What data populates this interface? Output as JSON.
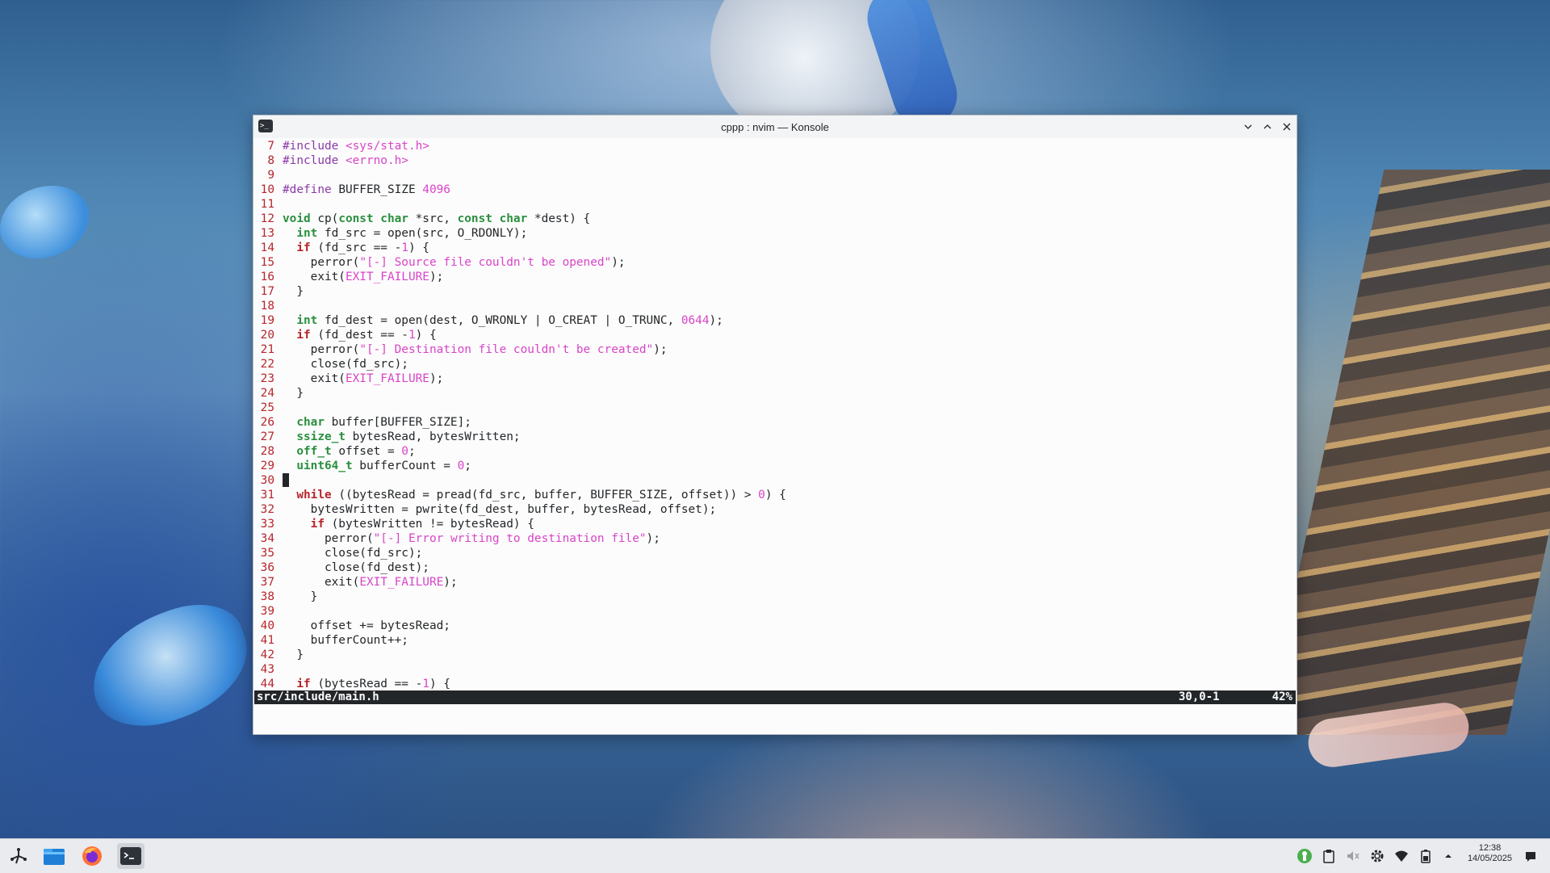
{
  "window": {
    "title": "cppp : nvim — Konsole",
    "app_icon_glyph": ">_"
  },
  "editor": {
    "lines": [
      {
        "n": "7",
        "segs": [
          {
            "t": "pp",
            "v": "#include "
          },
          {
            "t": "str",
            "v": "<sys/stat.h>"
          }
        ]
      },
      {
        "n": "8",
        "segs": [
          {
            "t": "pp",
            "v": "#include "
          },
          {
            "t": "str",
            "v": "<errno.h>"
          }
        ]
      },
      {
        "n": "9",
        "segs": []
      },
      {
        "n": "10",
        "segs": [
          {
            "t": "pp",
            "v": "#define "
          },
          {
            "t": "",
            "v": "BUFFER_SIZE "
          },
          {
            "t": "num",
            "v": "4096"
          }
        ]
      },
      {
        "n": "11",
        "segs": []
      },
      {
        "n": "12",
        "segs": [
          {
            "t": "ty",
            "v": "void"
          },
          {
            "t": "",
            "v": " cp("
          },
          {
            "t": "ty",
            "v": "const char"
          },
          {
            "t": "",
            "v": " *src, "
          },
          {
            "t": "ty",
            "v": "const char"
          },
          {
            "t": "",
            "v": " *dest) {"
          }
        ]
      },
      {
        "n": "13",
        "segs": [
          {
            "t": "",
            "v": "  "
          },
          {
            "t": "ty",
            "v": "int"
          },
          {
            "t": "",
            "v": " fd_src = open(src, O_RDONLY);"
          }
        ]
      },
      {
        "n": "14",
        "segs": [
          {
            "t": "",
            "v": "  "
          },
          {
            "t": "kw",
            "v": "if"
          },
          {
            "t": "",
            "v": " (fd_src == -"
          },
          {
            "t": "num",
            "v": "1"
          },
          {
            "t": "",
            "v": ") {"
          }
        ]
      },
      {
        "n": "15",
        "segs": [
          {
            "t": "",
            "v": "    perror("
          },
          {
            "t": "str",
            "v": "\"[-] Source file couldn't be opened\""
          },
          {
            "t": "",
            "v": ");"
          }
        ]
      },
      {
        "n": "16",
        "segs": [
          {
            "t": "",
            "v": "    exit("
          },
          {
            "t": "str",
            "v": "EXIT_FAILURE"
          },
          {
            "t": "",
            "v": ");"
          }
        ]
      },
      {
        "n": "17",
        "segs": [
          {
            "t": "",
            "v": "  }"
          }
        ]
      },
      {
        "n": "18",
        "segs": []
      },
      {
        "n": "19",
        "segs": [
          {
            "t": "",
            "v": "  "
          },
          {
            "t": "ty",
            "v": "int"
          },
          {
            "t": "",
            "v": " fd_dest = open(dest, O_WRONLY | O_CREAT | O_TRUNC, "
          },
          {
            "t": "num",
            "v": "0644"
          },
          {
            "t": "",
            "v": ");"
          }
        ]
      },
      {
        "n": "20",
        "segs": [
          {
            "t": "",
            "v": "  "
          },
          {
            "t": "kw",
            "v": "if"
          },
          {
            "t": "",
            "v": " (fd_dest == -"
          },
          {
            "t": "num",
            "v": "1"
          },
          {
            "t": "",
            "v": ") {"
          }
        ]
      },
      {
        "n": "21",
        "segs": [
          {
            "t": "",
            "v": "    perror("
          },
          {
            "t": "str",
            "v": "\"[-] Destination file couldn't be created\""
          },
          {
            "t": "",
            "v": ");"
          }
        ]
      },
      {
        "n": "22",
        "segs": [
          {
            "t": "",
            "v": "    close(fd_src);"
          }
        ]
      },
      {
        "n": "23",
        "segs": [
          {
            "t": "",
            "v": "    exit("
          },
          {
            "t": "str",
            "v": "EXIT_FAILURE"
          },
          {
            "t": "",
            "v": ");"
          }
        ]
      },
      {
        "n": "24",
        "segs": [
          {
            "t": "",
            "v": "  }"
          }
        ]
      },
      {
        "n": "25",
        "segs": []
      },
      {
        "n": "26",
        "segs": [
          {
            "t": "",
            "v": "  "
          },
          {
            "t": "ty",
            "v": "char"
          },
          {
            "t": "",
            "v": " buffer[BUFFER_SIZE];"
          }
        ]
      },
      {
        "n": "27",
        "segs": [
          {
            "t": "",
            "v": "  "
          },
          {
            "t": "ty",
            "v": "ssize_t"
          },
          {
            "t": "",
            "v": " bytesRead, bytesWritten;"
          }
        ]
      },
      {
        "n": "28",
        "segs": [
          {
            "t": "",
            "v": "  "
          },
          {
            "t": "ty",
            "v": "off_t"
          },
          {
            "t": "",
            "v": " offset = "
          },
          {
            "t": "num",
            "v": "0"
          },
          {
            "t": "",
            "v": ";"
          }
        ]
      },
      {
        "n": "29",
        "segs": [
          {
            "t": "",
            "v": "  "
          },
          {
            "t": "ty",
            "v": "uint64_t"
          },
          {
            "t": "",
            "v": " bufferCount = "
          },
          {
            "t": "num",
            "v": "0"
          },
          {
            "t": "",
            "v": ";"
          }
        ]
      },
      {
        "n": "30",
        "segs": [],
        "cursor": true
      },
      {
        "n": "31",
        "segs": [
          {
            "t": "",
            "v": "  "
          },
          {
            "t": "kw",
            "v": "while"
          },
          {
            "t": "",
            "v": " ((bytesRead = pread(fd_src, buffer, BUFFER_SIZE, offset)) > "
          },
          {
            "t": "num",
            "v": "0"
          },
          {
            "t": "",
            "v": ") {"
          }
        ]
      },
      {
        "n": "32",
        "segs": [
          {
            "t": "",
            "v": "    bytesWritten = pwrite(fd_dest, buffer, bytesRead, offset);"
          }
        ]
      },
      {
        "n": "33",
        "segs": [
          {
            "t": "",
            "v": "    "
          },
          {
            "t": "kw",
            "v": "if"
          },
          {
            "t": "",
            "v": " (bytesWritten != bytesRead) {"
          }
        ]
      },
      {
        "n": "34",
        "segs": [
          {
            "t": "",
            "v": "      perror("
          },
          {
            "t": "str",
            "v": "\"[-] Error writing to destination file\""
          },
          {
            "t": "",
            "v": ");"
          }
        ]
      },
      {
        "n": "35",
        "segs": [
          {
            "t": "",
            "v": "      close(fd_src);"
          }
        ]
      },
      {
        "n": "36",
        "segs": [
          {
            "t": "",
            "v": "      close(fd_dest);"
          }
        ]
      },
      {
        "n": "37",
        "segs": [
          {
            "t": "",
            "v": "      exit("
          },
          {
            "t": "str",
            "v": "EXIT_FAILURE"
          },
          {
            "t": "",
            "v": ");"
          }
        ]
      },
      {
        "n": "38",
        "segs": [
          {
            "t": "",
            "v": "    }"
          }
        ]
      },
      {
        "n": "39",
        "segs": []
      },
      {
        "n": "40",
        "segs": [
          {
            "t": "",
            "v": "    offset += bytesRead;"
          }
        ]
      },
      {
        "n": "41",
        "segs": [
          {
            "t": "",
            "v": "    bufferCount++;"
          }
        ]
      },
      {
        "n": "42",
        "segs": [
          {
            "t": "",
            "v": "  }"
          }
        ]
      },
      {
        "n": "43",
        "segs": []
      },
      {
        "n": "44",
        "segs": [
          {
            "t": "",
            "v": "  "
          },
          {
            "t": "kw",
            "v": "if"
          },
          {
            "t": "",
            "v": " (bytesRead == -"
          },
          {
            "t": "num",
            "v": "1"
          },
          {
            "t": "",
            "v": ") {"
          }
        ]
      }
    ]
  },
  "statusline": {
    "file": "src/include/main.h",
    "position": "30,0-1",
    "percent": "42%"
  },
  "taskbar": {
    "clock_time": "12:38",
    "clock_date": "14/05/2025"
  },
  "colors": {
    "line_number": "#b7262d",
    "keyword": "#b7262d",
    "type": "#2a8f3f",
    "preproc": "#8a3aa8",
    "string": "#d944c8"
  }
}
